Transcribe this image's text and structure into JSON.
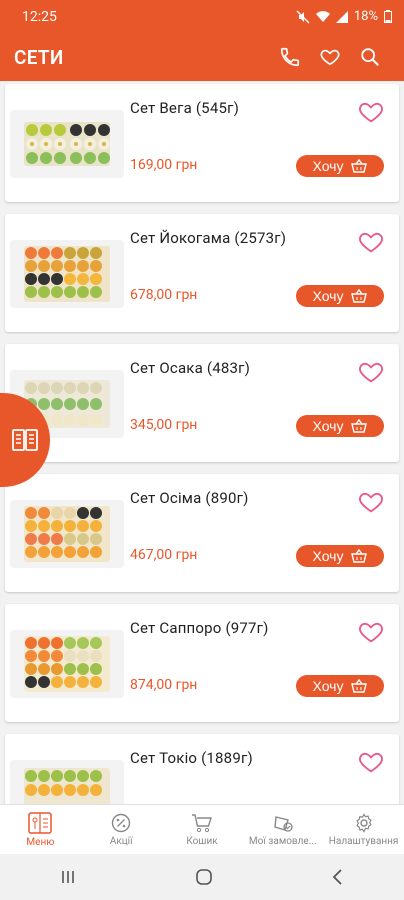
{
  "status": {
    "time": "12:25",
    "battery": "18%"
  },
  "appbar": {
    "title": "СЕТИ"
  },
  "products": [
    {
      "name": "Сет Вега (545г)",
      "price": "169,00 грн",
      "button": "Хочу"
    },
    {
      "name": "Сет Йокогама (2573г)",
      "price": "678,00 грн",
      "button": "Хочу"
    },
    {
      "name": "Сет Осака (483г)",
      "price": "345,00 грн",
      "button": "Хочу"
    },
    {
      "name": "Сет Осіма (890г)",
      "price": "467,00 грн",
      "button": "Хочу"
    },
    {
      "name": "Сет Саппоро (977г)",
      "price": "874,00 грн",
      "button": "Хочу"
    },
    {
      "name": "Сет Токіо (1889г)",
      "price": "",
      "button": ""
    }
  ],
  "bottom_nav": [
    {
      "label": "Меню",
      "icon": "menu-book-icon"
    },
    {
      "label": "Акції",
      "icon": "percent-icon"
    },
    {
      "label": "Кошик",
      "icon": "cart-icon"
    },
    {
      "label": "Мої замовле...",
      "icon": "orders-icon"
    },
    {
      "label": "Налаштування",
      "icon": "gear-icon"
    }
  ],
  "colors": {
    "accent": "#e8572a",
    "background": "#f2f2f2"
  }
}
